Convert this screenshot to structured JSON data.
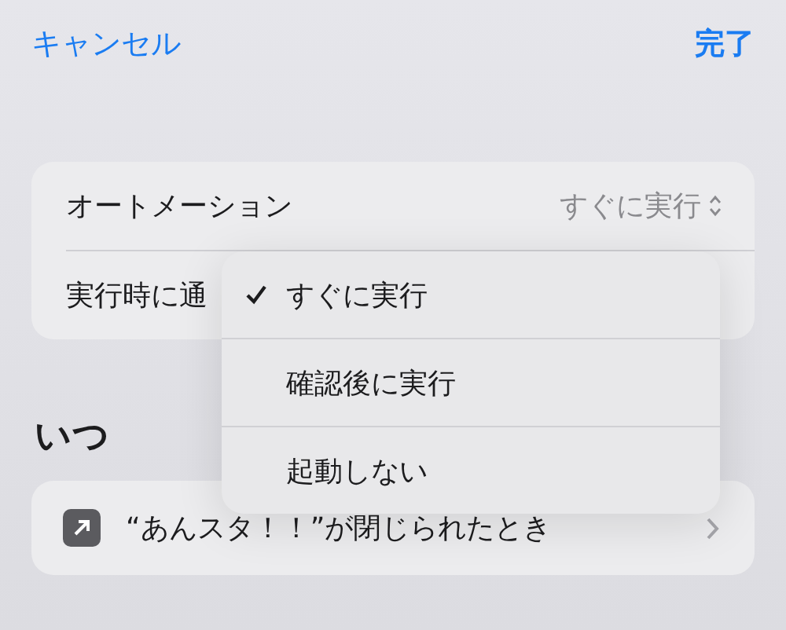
{
  "nav": {
    "cancel": "キャンセル",
    "done": "完了"
  },
  "settings": [
    {
      "label": "オートメーション",
      "value": "すぐに実行",
      "kind": "picker"
    },
    {
      "label": "実行時に通",
      "kind": "plain"
    }
  ],
  "menu": [
    {
      "label": "すぐに実行",
      "selected": true
    },
    {
      "label": "確認後に実行",
      "selected": false
    },
    {
      "label": "起動しない",
      "selected": false
    }
  ],
  "section_title": "いつ",
  "trigger": {
    "label": "“あんスタ！！”が閉じられたとき"
  }
}
